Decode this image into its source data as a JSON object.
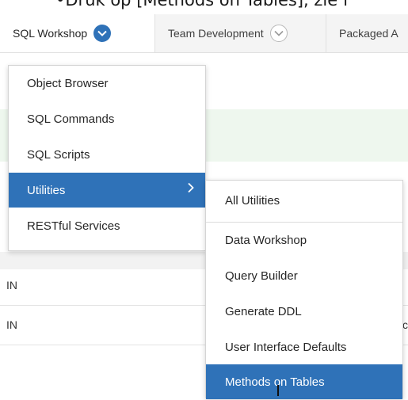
{
  "caption": "•Druk op [Methods on Tables], zie f",
  "tabs": [
    {
      "label": "SQL Workshop",
      "active": true
    },
    {
      "label": "Team Development",
      "active": false
    },
    {
      "label": "Packaged A",
      "active": false
    }
  ],
  "main_menu": {
    "items": [
      {
        "label": "Object Browser"
      },
      {
        "label": "SQL Commands"
      },
      {
        "label": "SQL Scripts"
      },
      {
        "label": "Utilities",
        "active": true,
        "has_submenu": true
      },
      {
        "label": "RESTful Services"
      }
    ]
  },
  "utilities_menu": {
    "items": [
      {
        "label": "All Utilities"
      },
      {
        "label": "Data Workshop"
      },
      {
        "label": "Query Builder"
      },
      {
        "label": "Generate DDL"
      },
      {
        "label": "User Interface Defaults"
      },
      {
        "label": "Methods on Tables",
        "active": true
      }
    ]
  },
  "background_rows": [
    {
      "left": "IN",
      "right": ""
    },
    {
      "left": "IN",
      "right": "c"
    }
  ],
  "colors": {
    "accent": "#2f72b8",
    "tab_bar": "#f4f4f4",
    "success_band": "#eef7ee"
  }
}
